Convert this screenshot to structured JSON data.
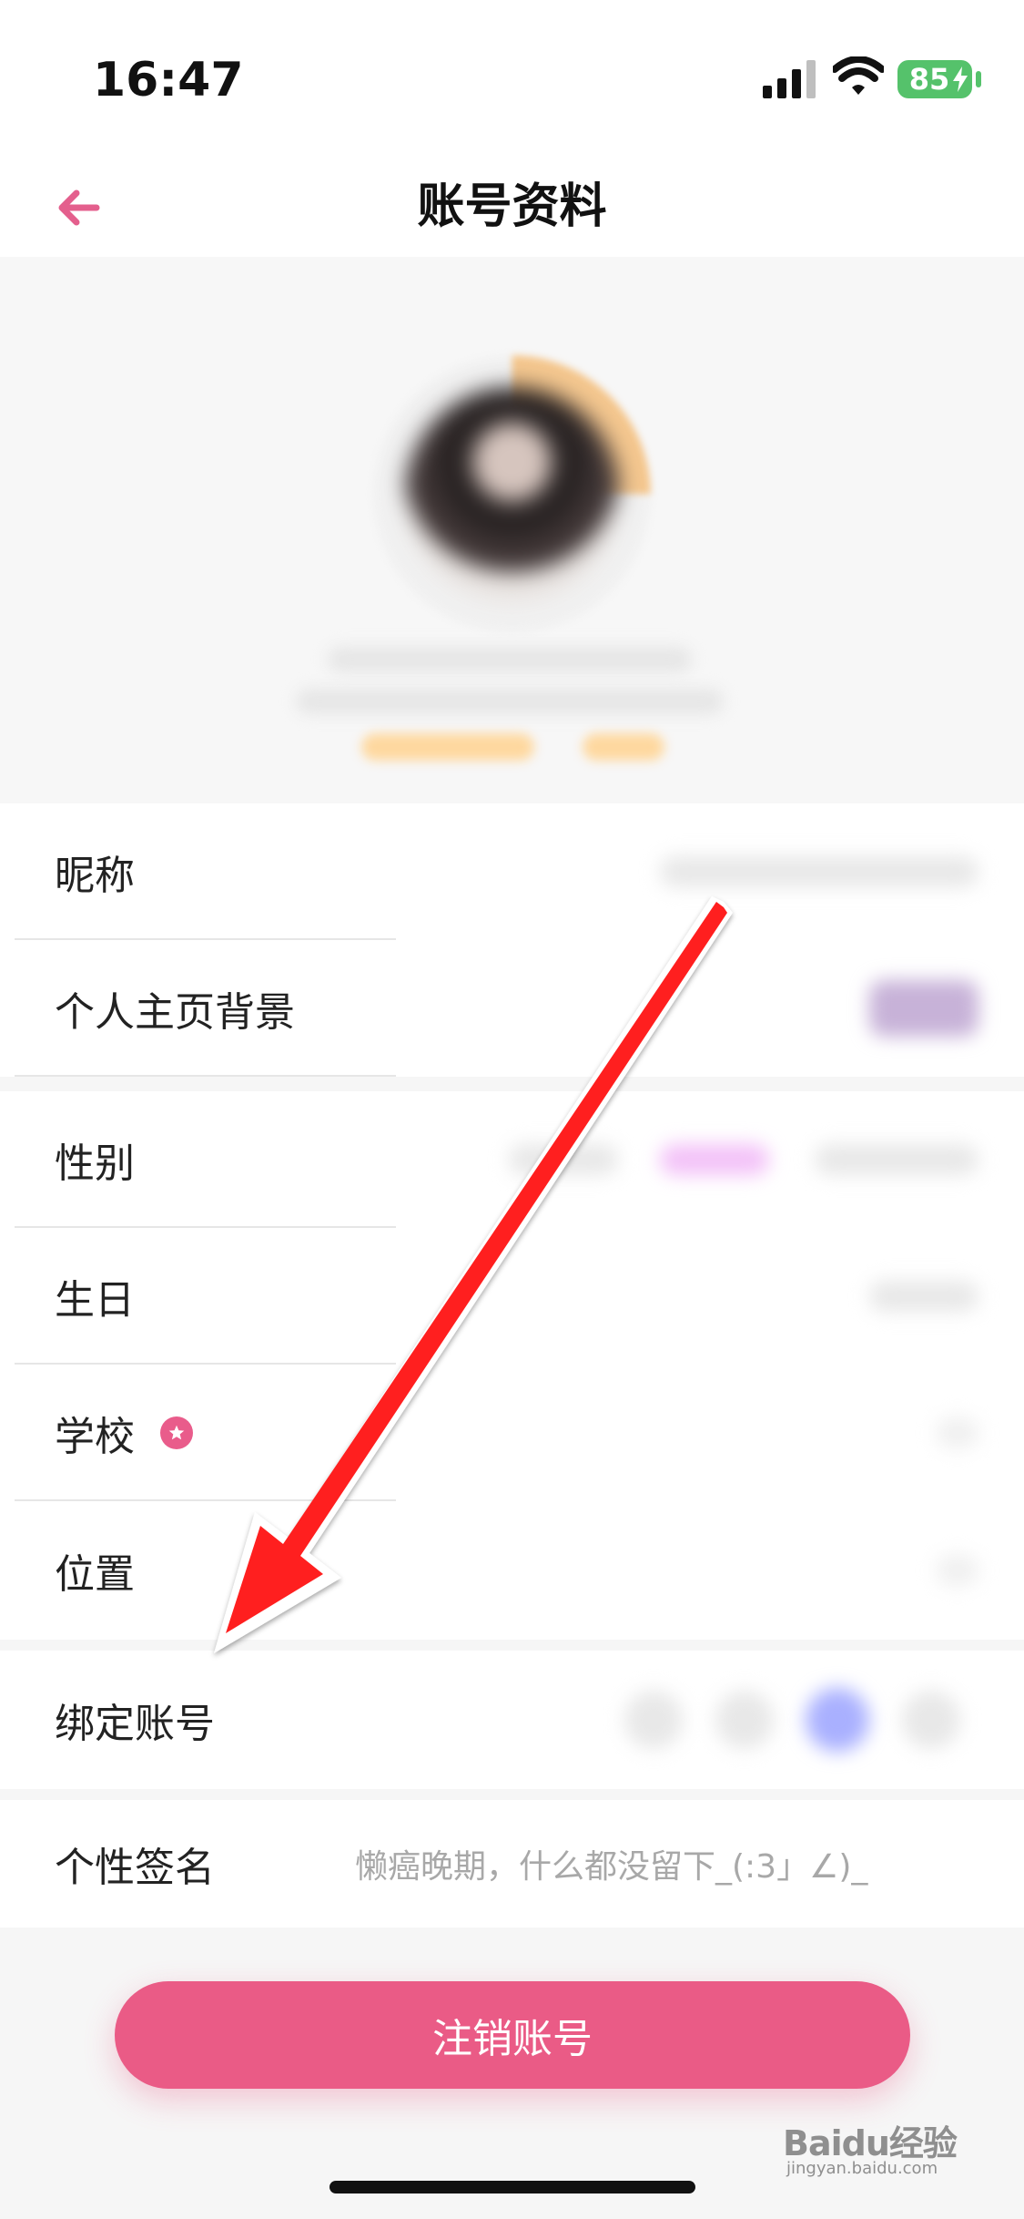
{
  "status": {
    "time": "16:47",
    "battery": "85"
  },
  "nav": {
    "title": "账号资料"
  },
  "rows": {
    "nickname": {
      "label": "昵称"
    },
    "background": {
      "label": "个人主页背景"
    },
    "gender": {
      "label": "性别"
    },
    "birthday": {
      "label": "生日"
    },
    "school": {
      "label": "学校"
    },
    "location": {
      "label": "位置"
    },
    "bind_account": {
      "label": "绑定账号"
    },
    "signature": {
      "label": "个性签名",
      "value": "懒癌晚期，什么都没留下_(:3」∠)_"
    }
  },
  "actions": {
    "logout_label": "注销账号"
  },
  "watermark": {
    "text": "Baidu经验",
    "url": "jingyan.baidu.com"
  },
  "colors": {
    "accent": "#ea5b86",
    "arrow": "#ff1f1f"
  },
  "icons": {
    "back": "arrow-left-icon",
    "signal": "signal-icon",
    "wifi": "wifi-icon",
    "battery": "battery-icon",
    "school_badge": "star-badge-icon"
  }
}
